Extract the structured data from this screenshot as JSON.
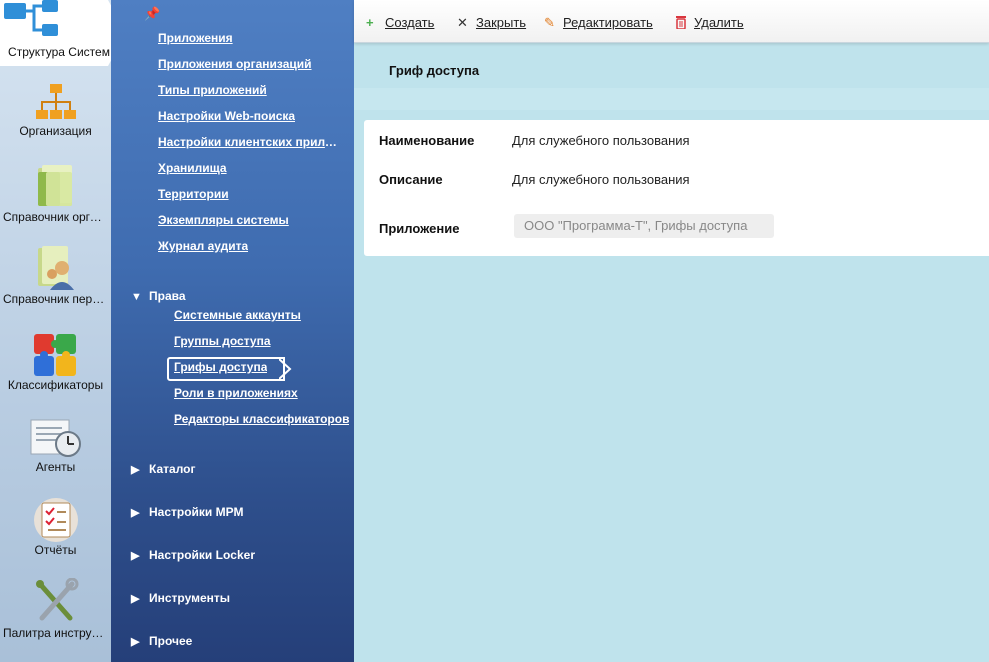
{
  "rail": {
    "items": [
      {
        "label": "Структура Систем",
        "icon": "system-structure-icon"
      },
      {
        "label": "Организация",
        "icon": "organization-chart-icon"
      },
      {
        "label": "Справочник организаций",
        "icon": "folder-icon"
      },
      {
        "label": "Справочник персонала",
        "icon": "personnel-folder-icon"
      },
      {
        "label": "Классификаторы",
        "icon": "puzzle-icon"
      },
      {
        "label": "Агенты",
        "icon": "agents-clock-icon"
      },
      {
        "label": "Отчёты",
        "icon": "reports-checklist-icon"
      },
      {
        "label": "Палитра инструментов",
        "icon": "tools-icon"
      }
    ]
  },
  "nav": {
    "links": [
      "Приложения",
      "Приложения организаций",
      "Типы приложений",
      "Настройки Web-поиска",
      "Настройки клиентских приложений",
      "Хранилища",
      "Территории",
      "Экземпляры системы",
      "Журнал аудита"
    ],
    "rights_section": "Права",
    "rights_items": [
      "Системные аккаунты",
      "Группы доступа",
      "Грифы доступа",
      "Роли в приложениях",
      "Редакторы классификаторов"
    ],
    "collapsed_sections": [
      "Каталог",
      "Настройки МРМ",
      "Настройки Locker",
      "Инструменты",
      "Прочее"
    ]
  },
  "toolbar": {
    "create": "Создать",
    "close": "Закрыть",
    "edit": "Редактировать",
    "delete": "Удалить"
  },
  "page": {
    "title": "Гриф доступа"
  },
  "form": {
    "name_label": "Наименование",
    "name_value": "Для служебного пользования",
    "description_label": "Описание",
    "description_value": "Для служебного пользования",
    "application_label": "Приложение",
    "application_value": "ООО \"Программа-Т\", Грифы доступа"
  },
  "colors": {
    "nav_top": "#4f7fc3",
    "nav_bottom": "#253f79",
    "content_bg": "#bfe3ec",
    "create_icon": "#4caf50",
    "edit_icon": "#e07b20",
    "delete_icon": "#d9363e"
  }
}
